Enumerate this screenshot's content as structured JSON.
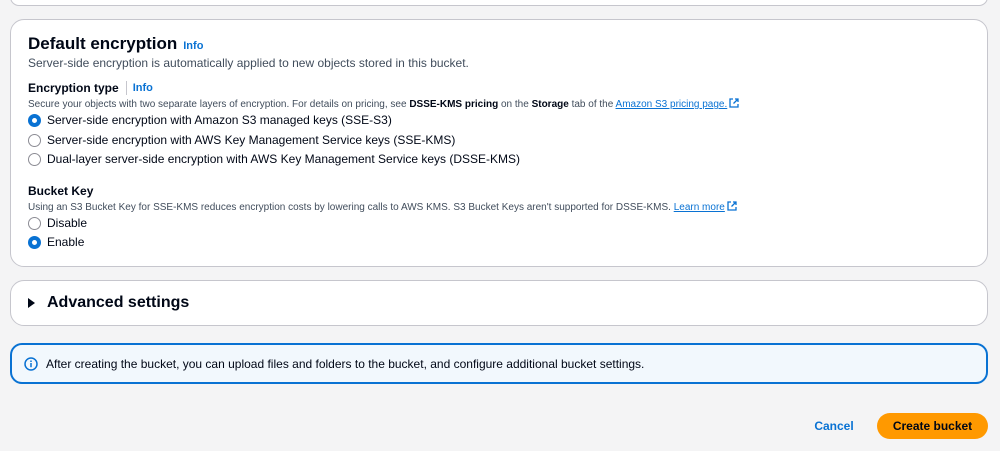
{
  "encryption": {
    "title": "Default encryption",
    "info": "Info",
    "description": "Server-side encryption is automatically applied to new objects stored in this bucket.",
    "type_label": "Encryption type",
    "type_info": "Info",
    "type_desc_pre": "Secure your objects with two separate layers of encryption. For details on pricing, see ",
    "type_desc_bold1": "DSSE-KMS pricing",
    "type_desc_mid": " on the ",
    "type_desc_bold2": "Storage",
    "type_desc_post": " tab of the ",
    "type_desc_link": "Amazon S3 pricing page.",
    "options": [
      {
        "label": "Server-side encryption with Amazon S3 managed keys (SSE-S3)",
        "checked": true
      },
      {
        "label": "Server-side encryption with AWS Key Management Service keys (SSE-KMS)",
        "checked": false
      },
      {
        "label": "Dual-layer server-side encryption with AWS Key Management Service keys (DSSE-KMS)",
        "checked": false
      }
    ]
  },
  "bucket_key": {
    "label": "Bucket Key",
    "desc": "Using an S3 Bucket Key for SSE-KMS reduces encryption costs by lowering calls to AWS KMS. S3 Bucket Keys aren't supported for DSSE-KMS. ",
    "learn_more": "Learn more",
    "options": [
      {
        "label": "Disable",
        "checked": false
      },
      {
        "label": "Enable",
        "checked": true
      }
    ]
  },
  "advanced": {
    "label": "Advanced settings"
  },
  "alert": {
    "text": "After creating the bucket, you can upload files and folders to the bucket, and configure additional bucket settings."
  },
  "actions": {
    "cancel": "Cancel",
    "create": "Create bucket"
  },
  "colors": {
    "accent": "#0972d3",
    "primary_button": "#ff9900",
    "alert_bg": "#f2f8fd"
  }
}
